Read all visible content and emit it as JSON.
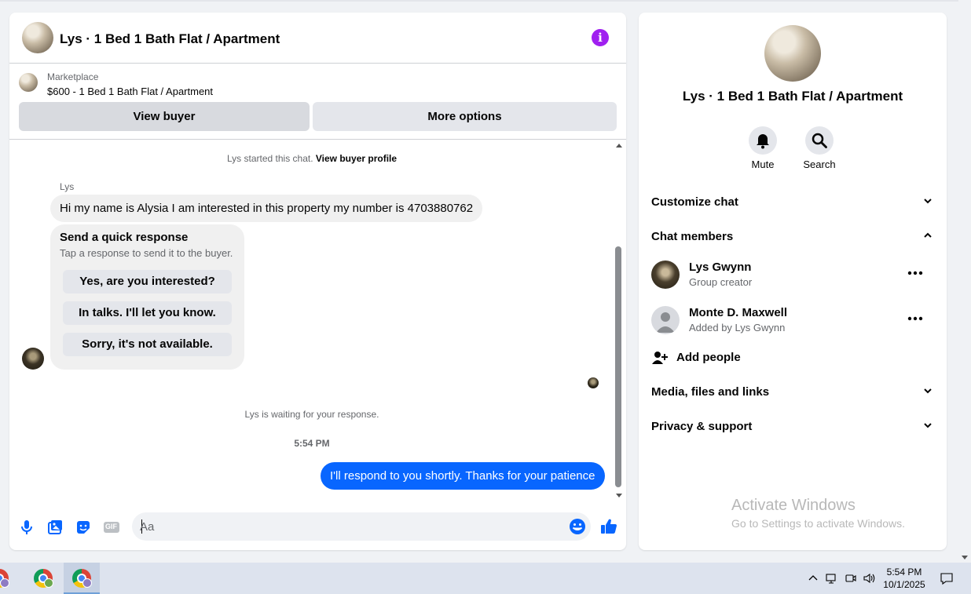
{
  "chat": {
    "header_title": "Lys · 1 Bed 1 Bath Flat / Apartment",
    "marketplace_label": "Marketplace",
    "listing_title": "$600 - 1 Bed 1 Bath Flat / Apartment",
    "view_buyer_label": "View buyer",
    "more_options_label": "More options",
    "started_text": "Lys started this chat.",
    "view_profile_link": "View buyer profile",
    "sender_name": "Lys",
    "incoming_message": "Hi my name is Alysia I am interested in this property my number is 4703880762",
    "quick_response": {
      "title": "Send a quick response",
      "subtitle": "Tap a response to send it to the buyer.",
      "options": [
        "Yes, are you interested?",
        "In talks. I'll let you know.",
        "Sorry, it's not available."
      ]
    },
    "waiting_text": "Lys is waiting for your response.",
    "timestamp": "5:54 PM",
    "outgoing_message": "I'll respond to you shortly. Thanks for your patience",
    "composer_placeholder": "Aa",
    "composer_icons": [
      "microphone-icon",
      "photo-icon",
      "sticker-icon",
      "gif-icon",
      "emoji-icon",
      "thumbs-up-icon"
    ],
    "gif_label": "GIF"
  },
  "side": {
    "title": "Lys · 1 Bed 1 Bath Flat / Apartment",
    "actions": [
      {
        "label": "Mute",
        "icon": "bell-icon"
      },
      {
        "label": "Search",
        "icon": "search-icon"
      }
    ],
    "sections": {
      "customize": "Customize chat",
      "members": "Chat members",
      "media": "Media, files and links",
      "privacy": "Privacy & support"
    },
    "members": [
      {
        "name": "Lys Gwynn",
        "role": "Group creator"
      },
      {
        "name": "Monte D. Maxwell",
        "role": "Added by Lys Gwynn"
      }
    ],
    "add_people_label": "Add people",
    "watermark_line1": "Activate Windows",
    "watermark_line2": "Go to Settings to activate Windows."
  },
  "taskbar": {
    "time": "5:54 PM",
    "date": "10/1/2025"
  },
  "colors": {
    "accent_blue": "#0866ff",
    "info_purple": "#a020f0",
    "bubble_gray": "#f0f0f0",
    "button_gray": "#e4e6eb"
  }
}
